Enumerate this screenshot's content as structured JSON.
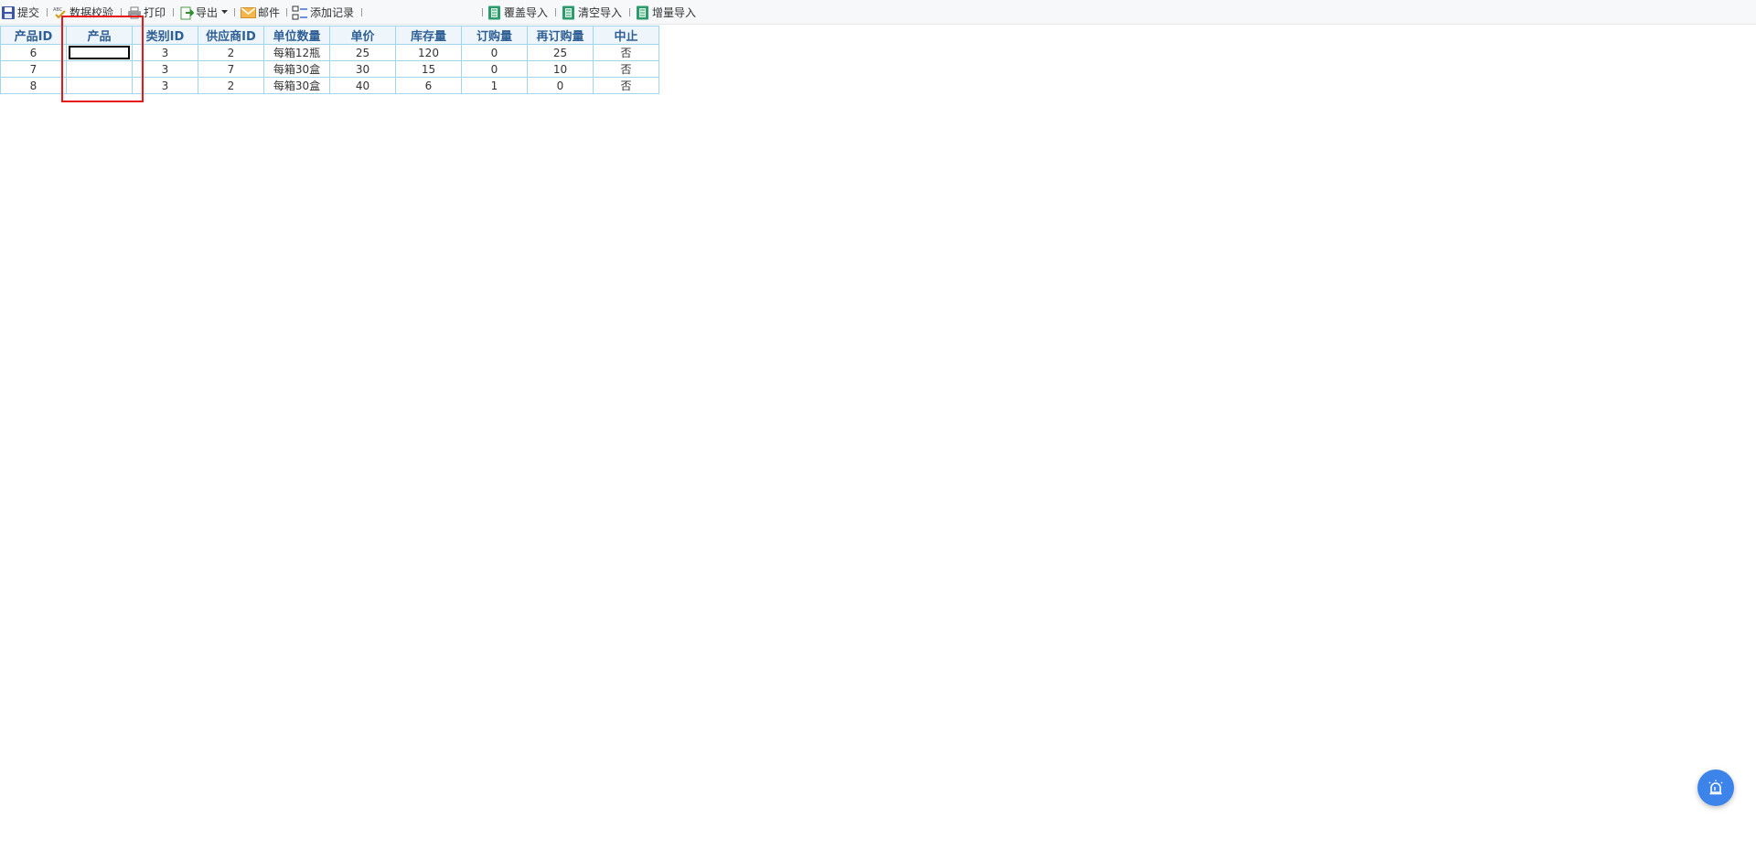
{
  "toolbar": {
    "submit": "提交",
    "validate": "数据校验",
    "print": "打印",
    "export": "导出",
    "mail": "邮件",
    "add_record": "添加记录",
    "overwrite_import": "覆盖导入",
    "clear_import": "清空导入",
    "incremental_import": "增量导入"
  },
  "table": {
    "headers": [
      "产品ID",
      "产品",
      "类别ID",
      "供应商ID",
      "单位数量",
      "单价",
      "库存量",
      "订购量",
      "再订购量",
      "中止"
    ],
    "rows": [
      [
        "6",
        "",
        "3",
        "2",
        "每箱12瓶",
        "25",
        "120",
        "0",
        "25",
        "否"
      ],
      [
        "7",
        "",
        "3",
        "7",
        "每箱30盒",
        "30",
        "15",
        "0",
        "10",
        "否"
      ],
      [
        "8",
        "",
        "3",
        "2",
        "每箱30盒",
        "40",
        "6",
        "1",
        "0",
        "否"
      ]
    ]
  },
  "colors": {
    "header_text": "#2f5f95",
    "grid_border": "#9fd6ee",
    "highlight": "#e81818",
    "fab": "#3d84ea"
  },
  "icons": {
    "fab": "alarm-icon"
  }
}
